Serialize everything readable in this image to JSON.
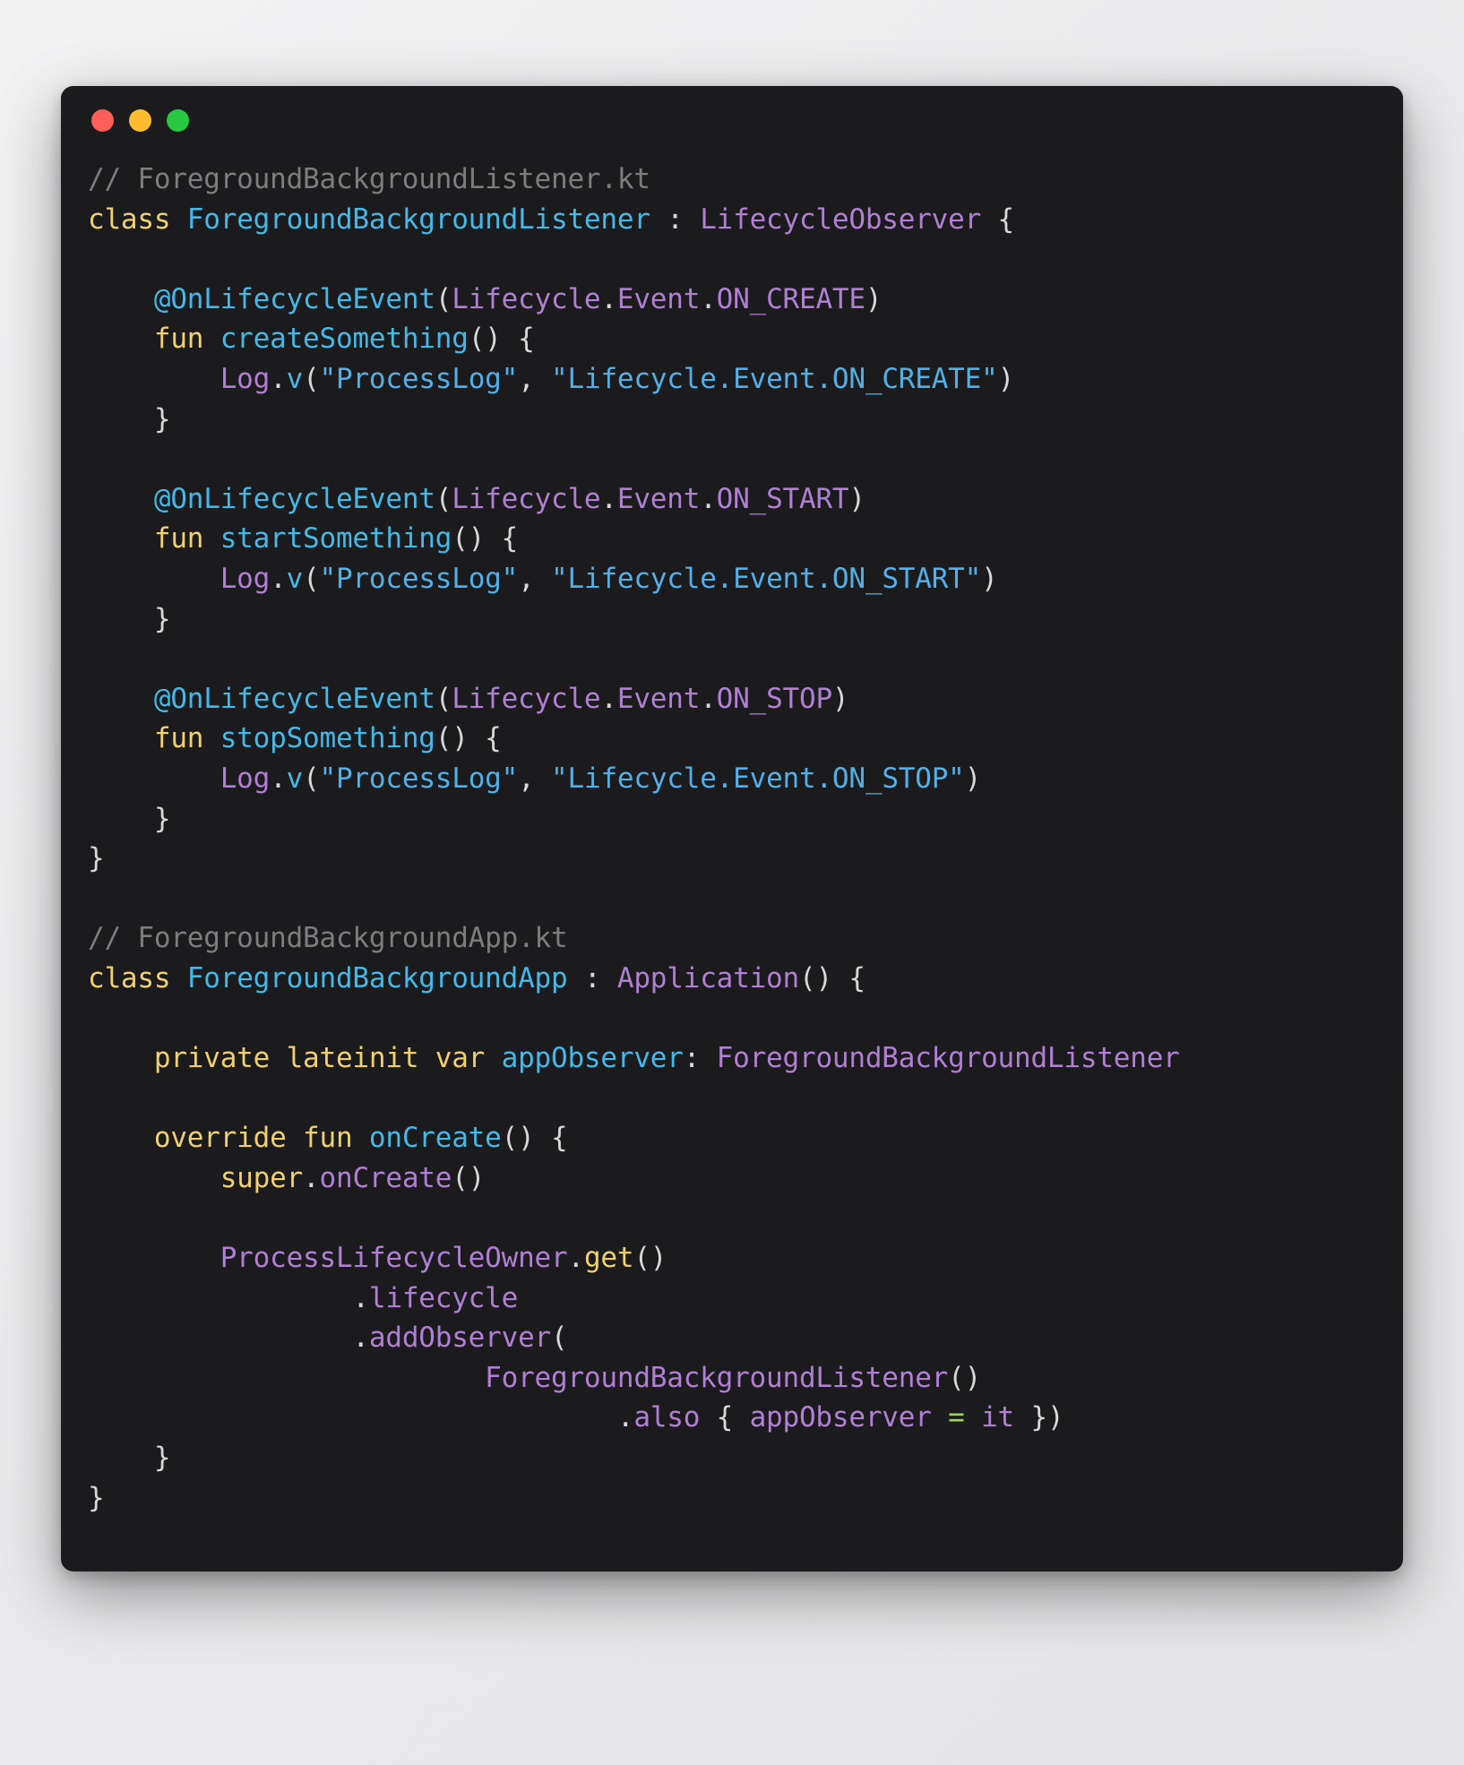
{
  "window": {
    "title": "",
    "traffic_lights": [
      {
        "name": "close-button",
        "color": "#ff5f57"
      },
      {
        "name": "minimize-button",
        "color": "#febc2e"
      },
      {
        "name": "maximize-button",
        "color": "#28c840"
      }
    ]
  },
  "theme": {
    "background": "#1b1b1d",
    "page_background": "#ececee",
    "comment": "#7d7d7d",
    "keyword": "#f0d070",
    "type": "#44b9e8",
    "class_or_property": "#b07fd4",
    "string": "#52b0e8",
    "punctuation": "#d8d8d8",
    "operator": "#9fd459"
  },
  "code": {
    "language": "kotlin",
    "files": [
      "ForegroundBackgroundListener.kt",
      "ForegroundBackgroundApp.kt"
    ],
    "lines": [
      {
        "id": "l1",
        "tokens": [
          {
            "t": "// ForegroundBackgroundListener.kt",
            "k": "comment"
          }
        ]
      },
      {
        "id": "l2",
        "tokens": [
          {
            "t": "class ",
            "k": "key"
          },
          {
            "t": "ForegroundBackgroundListener ",
            "k": "type"
          },
          {
            "t": ": ",
            "k": "punct"
          },
          {
            "t": "LifecycleObserver",
            "k": "class"
          },
          {
            "t": " {",
            "k": "punct"
          }
        ]
      },
      {
        "id": "l3",
        "tokens": []
      },
      {
        "id": "l4",
        "tokens": [
          {
            "t": "    ",
            "k": "punct"
          },
          {
            "t": "@OnLifecycleEvent",
            "k": "type"
          },
          {
            "t": "(",
            "k": "punct"
          },
          {
            "t": "Lifecycle",
            "k": "class"
          },
          {
            "t": ".",
            "k": "punct"
          },
          {
            "t": "Event",
            "k": "class"
          },
          {
            "t": ".",
            "k": "punct"
          },
          {
            "t": "ON_CREATE",
            "k": "class"
          },
          {
            "t": ")",
            "k": "punct"
          }
        ]
      },
      {
        "id": "l5",
        "tokens": [
          {
            "t": "    ",
            "k": "punct"
          },
          {
            "t": "fun ",
            "k": "key"
          },
          {
            "t": "createSomething",
            "k": "fn"
          },
          {
            "t": "() {",
            "k": "punct"
          }
        ]
      },
      {
        "id": "l6",
        "tokens": [
          {
            "t": "        ",
            "k": "punct"
          },
          {
            "t": "Log",
            "k": "class"
          },
          {
            "t": ".",
            "k": "punct"
          },
          {
            "t": "v",
            "k": "fn"
          },
          {
            "t": "(",
            "k": "punct"
          },
          {
            "t": "\"ProcessLog\"",
            "k": "str"
          },
          {
            "t": ", ",
            "k": "punct"
          },
          {
            "t": "\"Lifecycle.Event.ON_CREATE\"",
            "k": "str"
          },
          {
            "t": ")",
            "k": "punct"
          }
        ]
      },
      {
        "id": "l7",
        "tokens": [
          {
            "t": "    }",
            "k": "punct"
          }
        ]
      },
      {
        "id": "l8",
        "tokens": []
      },
      {
        "id": "l9",
        "tokens": [
          {
            "t": "    ",
            "k": "punct"
          },
          {
            "t": "@OnLifecycleEvent",
            "k": "type"
          },
          {
            "t": "(",
            "k": "punct"
          },
          {
            "t": "Lifecycle",
            "k": "class"
          },
          {
            "t": ".",
            "k": "punct"
          },
          {
            "t": "Event",
            "k": "class"
          },
          {
            "t": ".",
            "k": "punct"
          },
          {
            "t": "ON_START",
            "k": "class"
          },
          {
            "t": ")",
            "k": "punct"
          }
        ]
      },
      {
        "id": "l10",
        "tokens": [
          {
            "t": "    ",
            "k": "punct"
          },
          {
            "t": "fun ",
            "k": "key"
          },
          {
            "t": "startSomething",
            "k": "fn"
          },
          {
            "t": "() {",
            "k": "punct"
          }
        ]
      },
      {
        "id": "l11",
        "tokens": [
          {
            "t": "        ",
            "k": "punct"
          },
          {
            "t": "Log",
            "k": "class"
          },
          {
            "t": ".",
            "k": "punct"
          },
          {
            "t": "v",
            "k": "fn"
          },
          {
            "t": "(",
            "k": "punct"
          },
          {
            "t": "\"ProcessLog\"",
            "k": "str"
          },
          {
            "t": ", ",
            "k": "punct"
          },
          {
            "t": "\"Lifecycle.Event.ON_START\"",
            "k": "str"
          },
          {
            "t": ")",
            "k": "punct"
          }
        ]
      },
      {
        "id": "l12",
        "tokens": [
          {
            "t": "    }",
            "k": "punct"
          }
        ]
      },
      {
        "id": "l13",
        "tokens": []
      },
      {
        "id": "l14",
        "tokens": [
          {
            "t": "    ",
            "k": "punct"
          },
          {
            "t": "@OnLifecycleEvent",
            "k": "type"
          },
          {
            "t": "(",
            "k": "punct"
          },
          {
            "t": "Lifecycle",
            "k": "class"
          },
          {
            "t": ".",
            "k": "punct"
          },
          {
            "t": "Event",
            "k": "class"
          },
          {
            "t": ".",
            "k": "punct"
          },
          {
            "t": "ON_STOP",
            "k": "class"
          },
          {
            "t": ")",
            "k": "punct"
          }
        ]
      },
      {
        "id": "l15",
        "tokens": [
          {
            "t": "    ",
            "k": "punct"
          },
          {
            "t": "fun ",
            "k": "key"
          },
          {
            "t": "stopSomething",
            "k": "fn"
          },
          {
            "t": "() {",
            "k": "punct"
          }
        ]
      },
      {
        "id": "l16",
        "tokens": [
          {
            "t": "        ",
            "k": "punct"
          },
          {
            "t": "Log",
            "k": "class"
          },
          {
            "t": ".",
            "k": "punct"
          },
          {
            "t": "v",
            "k": "fn"
          },
          {
            "t": "(",
            "k": "punct"
          },
          {
            "t": "\"ProcessLog\"",
            "k": "str"
          },
          {
            "t": ", ",
            "k": "punct"
          },
          {
            "t": "\"Lifecycle.Event.ON_STOP\"",
            "k": "str"
          },
          {
            "t": ")",
            "k": "punct"
          }
        ]
      },
      {
        "id": "l17",
        "tokens": [
          {
            "t": "    }",
            "k": "punct"
          }
        ]
      },
      {
        "id": "l18",
        "tokens": [
          {
            "t": "}",
            "k": "punct"
          }
        ]
      },
      {
        "id": "l19",
        "tokens": []
      },
      {
        "id": "l20",
        "tokens": [
          {
            "t": "// ForegroundBackgroundApp.kt",
            "k": "comment"
          }
        ]
      },
      {
        "id": "l21",
        "tokens": [
          {
            "t": "class ",
            "k": "key"
          },
          {
            "t": "ForegroundBackgroundApp ",
            "k": "type"
          },
          {
            "t": ": ",
            "k": "punct"
          },
          {
            "t": "Application",
            "k": "class"
          },
          {
            "t": "() {",
            "k": "punct"
          }
        ]
      },
      {
        "id": "l22",
        "tokens": []
      },
      {
        "id": "l23",
        "tokens": [
          {
            "t": "    ",
            "k": "punct"
          },
          {
            "t": "private lateinit var ",
            "k": "key"
          },
          {
            "t": "appObserver",
            "k": "ident"
          },
          {
            "t": ": ",
            "k": "punct"
          },
          {
            "t": "ForegroundBackgroundListener",
            "k": "class"
          }
        ]
      },
      {
        "id": "l24",
        "tokens": []
      },
      {
        "id": "l25",
        "tokens": [
          {
            "t": "    ",
            "k": "punct"
          },
          {
            "t": "override fun ",
            "k": "key"
          },
          {
            "t": "onCreate",
            "k": "fn"
          },
          {
            "t": "() {",
            "k": "punct"
          }
        ]
      },
      {
        "id": "l26",
        "tokens": [
          {
            "t": "        ",
            "k": "punct"
          },
          {
            "t": "super",
            "k": "key"
          },
          {
            "t": ".",
            "k": "punct"
          },
          {
            "t": "onCreate",
            "k": "prop"
          },
          {
            "t": "()",
            "k": "punct"
          }
        ]
      },
      {
        "id": "l27",
        "tokens": []
      },
      {
        "id": "l28",
        "tokens": [
          {
            "t": "        ",
            "k": "punct"
          },
          {
            "t": "ProcessLifecycleOwner",
            "k": "class"
          },
          {
            "t": ".",
            "k": "punct"
          },
          {
            "t": "get",
            "k": "key"
          },
          {
            "t": "()",
            "k": "punct"
          }
        ]
      },
      {
        "id": "l29",
        "tokens": [
          {
            "t": "                ",
            "k": "punct"
          },
          {
            "t": ".",
            "k": "punct"
          },
          {
            "t": "lifecycle",
            "k": "prop"
          }
        ]
      },
      {
        "id": "l30",
        "tokens": [
          {
            "t": "                ",
            "k": "punct"
          },
          {
            "t": ".",
            "k": "punct"
          },
          {
            "t": "addObserver",
            "k": "prop"
          },
          {
            "t": "(",
            "k": "punct"
          }
        ]
      },
      {
        "id": "l31",
        "tokens": [
          {
            "t": "                        ",
            "k": "punct"
          },
          {
            "t": "ForegroundBackgroundListener",
            "k": "class"
          },
          {
            "t": "()",
            "k": "punct"
          }
        ]
      },
      {
        "id": "l32",
        "tokens": [
          {
            "t": "                                ",
            "k": "punct"
          },
          {
            "t": ".",
            "k": "punct"
          },
          {
            "t": "also",
            "k": "prop"
          },
          {
            "t": " { ",
            "k": "punct"
          },
          {
            "t": "appObserver",
            "k": "prop"
          },
          {
            "t": " ",
            "k": "punct"
          },
          {
            "t": "=",
            "k": "op"
          },
          {
            "t": " ",
            "k": "punct"
          },
          {
            "t": "it",
            "k": "prop"
          },
          {
            "t": " })",
            "k": "punct"
          }
        ]
      },
      {
        "id": "l33",
        "tokens": [
          {
            "t": "    }",
            "k": "punct"
          }
        ]
      },
      {
        "id": "l34",
        "tokens": [
          {
            "t": "}",
            "k": "punct"
          }
        ]
      }
    ]
  }
}
